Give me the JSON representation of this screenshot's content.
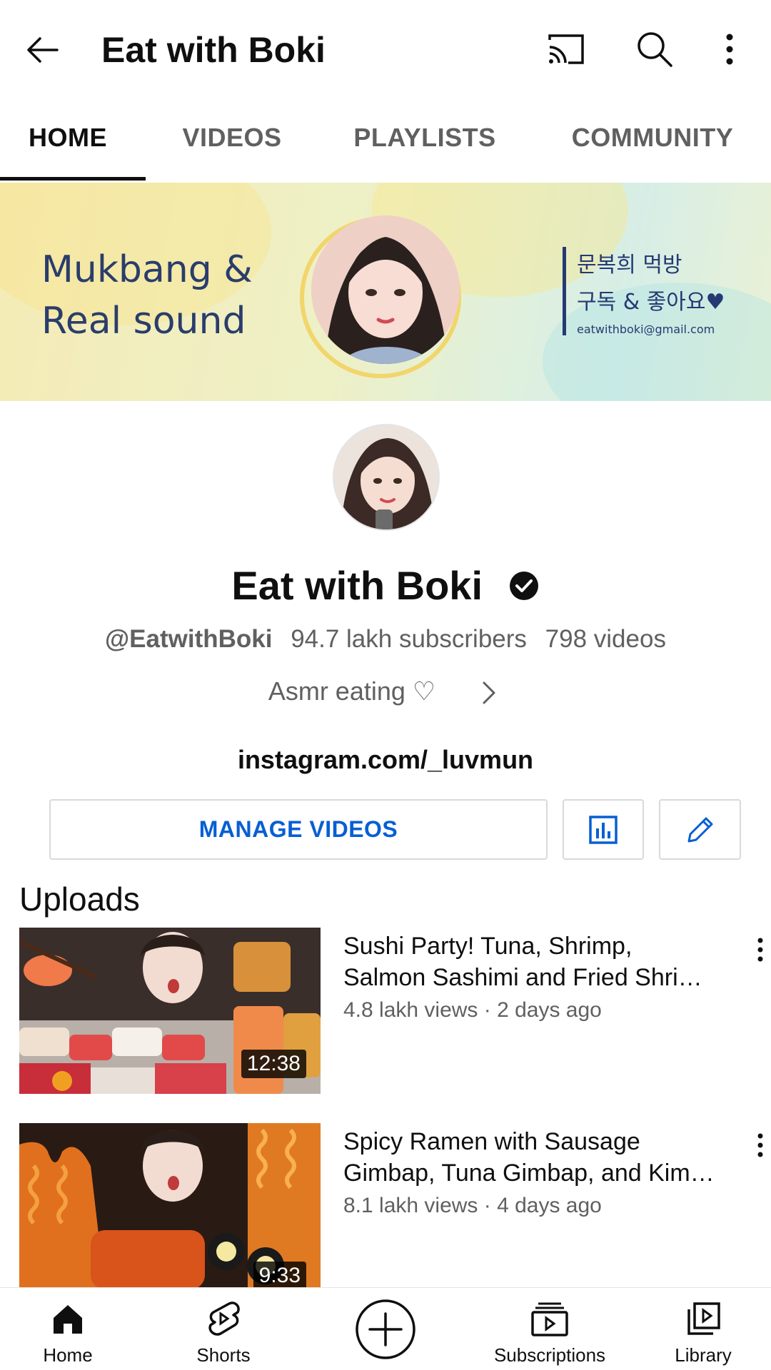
{
  "appbar": {
    "title": "Eat with Boki",
    "icons": [
      "back-arrow-icon",
      "cast-icon",
      "search-icon",
      "more-vert-icon"
    ]
  },
  "tabs": [
    {
      "label": "HOME",
      "active": true
    },
    {
      "label": "VIDEOS",
      "active": false
    },
    {
      "label": "PLAYLISTS",
      "active": false
    },
    {
      "label": "COMMUNITY",
      "active": false
    }
  ],
  "banner": {
    "left_line1": "Mukbang &",
    "left_line2": "Real sound",
    "right_line1": "문복희 먹방",
    "right_line2": "구독 & 좋아요♥",
    "email": "eatwithboki@gmail.com"
  },
  "channel": {
    "name": "Eat with Boki",
    "verified": true,
    "handle": "@EatwithBoki",
    "subscribers": "94.7 lakh subscribers",
    "videos": "798 videos",
    "description": "Asmr eating ♡",
    "link": "instagram.com/_luvmun"
  },
  "actions": {
    "manage_videos": "MANAGE VIDEOS",
    "analytics_icon": "analytics-icon",
    "edit_icon": "edit-pencil-icon",
    "accent": "#065fd4"
  },
  "uploads": {
    "title": "Uploads",
    "videos": [
      {
        "title_line1": "Sushi Party! Tuna, Shrimp,",
        "title_line2": "Salmon Sashimi and Fried Shri…",
        "meta": "4.8 lakh views · 2 days ago",
        "duration": "12:38"
      },
      {
        "title_line1": "Spicy Ramen with Sausage",
        "title_line2": "Gimbap, Tuna Gimbap, and Kim…",
        "meta": "8.1 lakh views · 4 days ago",
        "duration": "9:33"
      }
    ]
  },
  "bottomnav": {
    "items": [
      {
        "label": "Home",
        "icon": "home-icon"
      },
      {
        "label": "Shorts",
        "icon": "shorts-icon"
      },
      {
        "label": "",
        "icon": "create-plus-icon"
      },
      {
        "label": "Subscriptions",
        "icon": "subscriptions-icon"
      },
      {
        "label": "Library",
        "icon": "library-icon"
      }
    ]
  }
}
